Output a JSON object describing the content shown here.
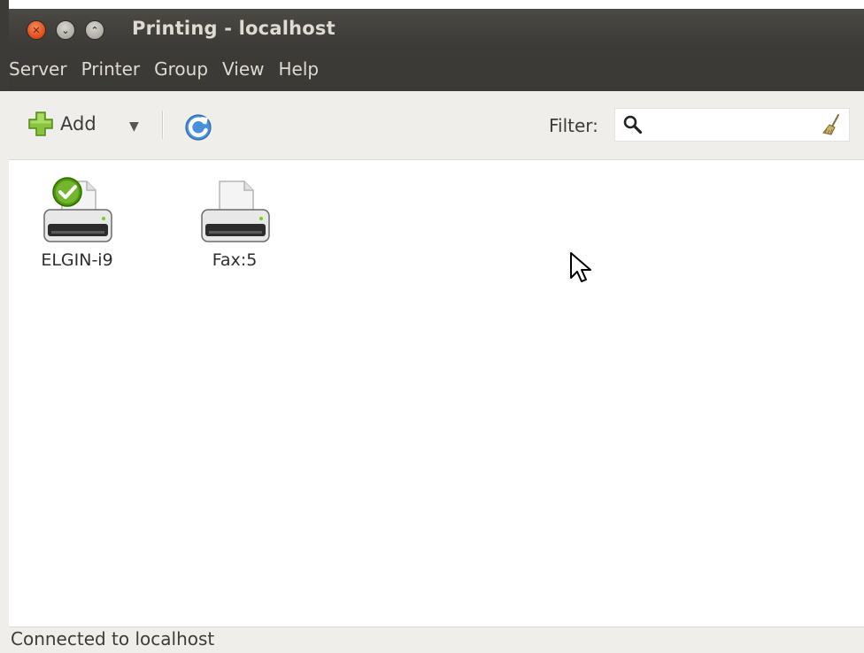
{
  "window": {
    "title": "Printing - localhost",
    "controls": {
      "close_icon": "close-icon",
      "minimize_icon": "minimize-icon",
      "maximize_icon": "maximize-icon"
    }
  },
  "menubar": {
    "items": [
      {
        "label": "Server"
      },
      {
        "label": "Printer"
      },
      {
        "label": "Group"
      },
      {
        "label": "View"
      },
      {
        "label": "Help"
      }
    ]
  },
  "toolbar": {
    "add_label": "Add",
    "add_icon": "plus-icon",
    "dropdown_icon": "dropdown-arrow-icon",
    "refresh_icon": "refresh-icon",
    "filter_label": "Filter:",
    "filter_value": "",
    "filter_placeholder": "",
    "search_icon": "search-icon",
    "clear_icon": "clear-broom-icon"
  },
  "printers": [
    {
      "name": "ELGIN-i9",
      "is_default": true
    },
    {
      "name": "Fax:5",
      "is_default": false
    }
  ],
  "status": {
    "text": "Connected to localhost"
  },
  "colors": {
    "titlebar": "#3c3b37",
    "toolbar": "#f0eeea",
    "close_button": "#df4a16",
    "default_badge": "#4e9a06"
  }
}
